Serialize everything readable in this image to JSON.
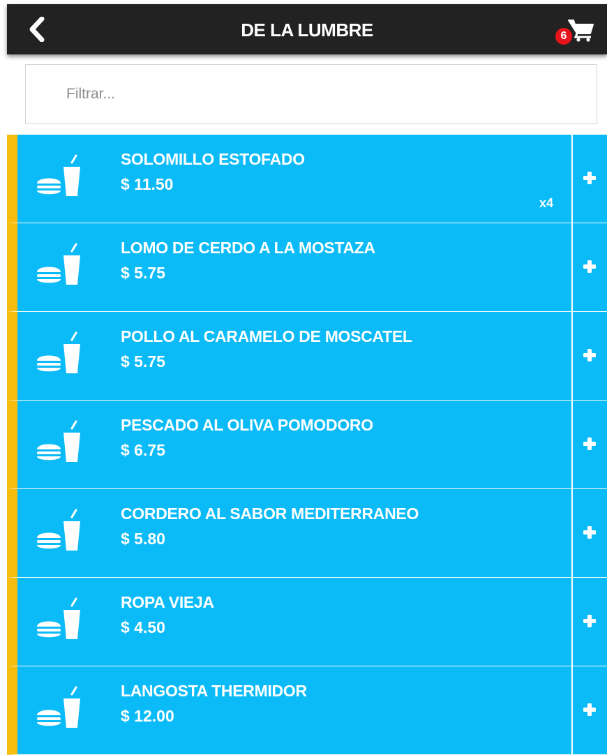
{
  "header": {
    "title": "DE LA LUMBRE",
    "back_icon": "chevron-left-icon",
    "cart_icon": "shopping-cart-icon",
    "cart_count": "6"
  },
  "filter": {
    "value": "",
    "placeholder": "Filtrar..."
  },
  "colors": {
    "header_bg": "#222222",
    "item_bg": "#0bbbf7",
    "accent_bar": "#f6bd0e",
    "badge": "#e8141c"
  },
  "items": [
    {
      "name": "SOLOMILLO ESTOFADO",
      "price": "$ 11.50",
      "qty": "x4",
      "icon": "food-drink-icon",
      "add_icon": "plus-icon"
    },
    {
      "name": "LOMO DE CERDO A LA MOSTAZA",
      "price": "$ 5.75",
      "qty": "",
      "icon": "food-drink-icon",
      "add_icon": "plus-icon"
    },
    {
      "name": "POLLO AL CARAMELO DE MOSCATEL",
      "price": "$ 5.75",
      "qty": "",
      "icon": "food-drink-icon",
      "add_icon": "plus-icon"
    },
    {
      "name": "PESCADO AL OLIVA POMODORO",
      "price": "$ 6.75",
      "qty": "",
      "icon": "food-drink-icon",
      "add_icon": "plus-icon"
    },
    {
      "name": "CORDERO AL SABOR MEDITERRANEO",
      "price": "$ 5.80",
      "qty": "",
      "icon": "food-drink-icon",
      "add_icon": "plus-icon"
    },
    {
      "name": "ROPA VIEJA",
      "price": "$ 4.50",
      "qty": "",
      "icon": "food-drink-icon",
      "add_icon": "plus-icon"
    },
    {
      "name": "LANGOSTA THERMIDOR",
      "price": "$ 12.00",
      "qty": "",
      "icon": "food-drink-icon",
      "add_icon": "plus-icon"
    }
  ]
}
